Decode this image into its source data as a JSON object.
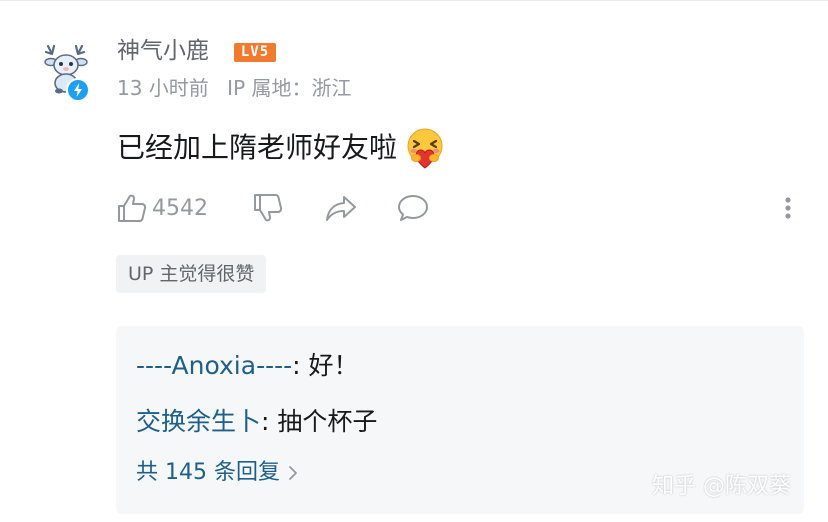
{
  "comment": {
    "username": "神气小鹿",
    "level_badge": "LV5",
    "time": "13 小时前",
    "ip_location": "IP 属地：浙江",
    "text": "已经加上隋老师好友啦",
    "emoji_icon": "hug-heart-emoji-icon",
    "like_count": "4542",
    "up_tag": "UP 主觉得很赞"
  },
  "replies": {
    "items": [
      {
        "author": "----Anoxia----",
        "text": ": 好！"
      },
      {
        "author": "交换余生卜",
        "text": ": 抽个杯子"
      }
    ],
    "total_label": "共 145 条回复"
  },
  "watermark": "知乎 @陈双葵",
  "colors": {
    "level_badge": "#f07a2e",
    "reply_link": "#1d5f8a",
    "verify_badge": "#1e9ff2",
    "muted_text": "#9499a0"
  }
}
